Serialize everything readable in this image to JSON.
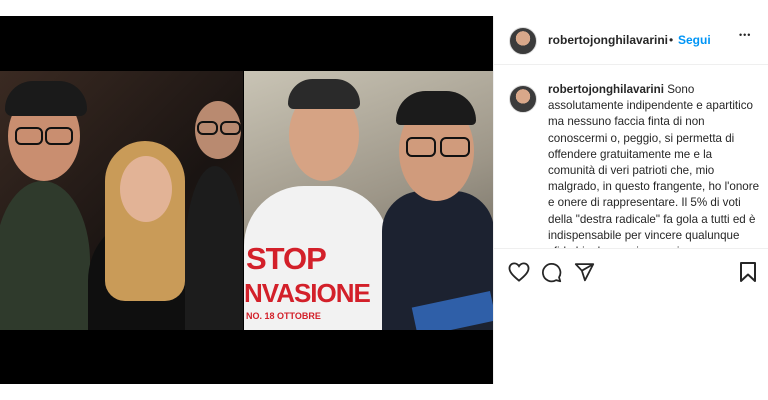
{
  "post": {
    "username": "robertojonghilavarini",
    "separator": "•",
    "follow_label": "Segui",
    "more_label": "•••",
    "caption_username": "robertojonghilavarini",
    "caption_text": "Sono assolutamente indipendente e apartitico ma nessuno faccia finta di non conoscermi o, peggio, si permetta di offendere gratuitamente me e la comunità di veri patrioti che, mio malgrado, in questo frangente, ho l'onore e onere di rappresentare. Il 5% di voti della \"destra radicale\" fa gola a tutti ed è indispensabile per vincere qualunque sfida bipolare, nei comuni e",
    "photo_texts": {
      "stop": "STOP",
      "invasione": "NVASIONE",
      "date": "NO. 18 OTTOBRE"
    }
  },
  "icons": {
    "like": "heart-icon",
    "comment": "comment-icon",
    "share": "paper-plane-icon",
    "save": "bookmark-icon"
  },
  "colors": {
    "accent": "#0095f6",
    "text": "#262626",
    "border": "#efefef",
    "media_bg": "#000000"
  }
}
